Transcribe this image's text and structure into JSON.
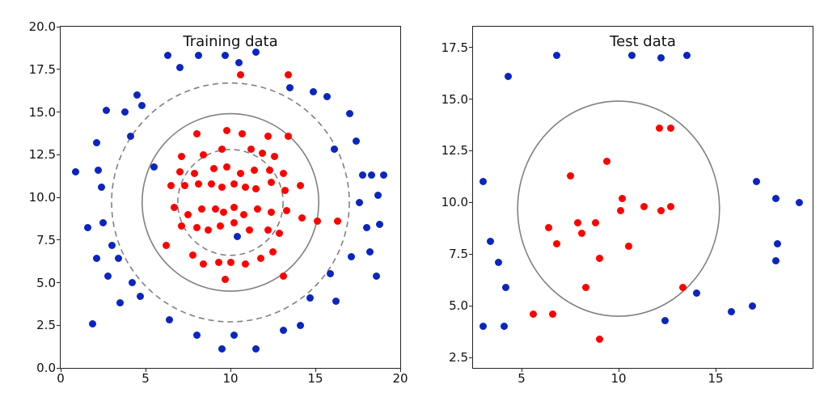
{
  "chart_data": [
    {
      "type": "scatter",
      "title": "Training data",
      "xlim": [
        0,
        20
      ],
      "ylim": [
        0,
        20
      ],
      "xticks": [
        0,
        5,
        10,
        15,
        20
      ],
      "yticks": [
        0.0,
        2.5,
        5.0,
        7.5,
        10.0,
        12.5,
        15.0,
        17.5,
        20.0
      ],
      "boundary_center": [
        10,
        9.7
      ],
      "boundary_radii": {
        "dashed_inner": 3.1,
        "solid": 5.2,
        "dashed_outer": 7.0
      },
      "series": [
        {
          "name": "class-red",
          "color": "#ff0000",
          "points": [
            [
              10.6,
              17.2
            ],
            [
              13.4,
              17.2
            ],
            [
              8.0,
              13.7
            ],
            [
              9.8,
              13.9
            ],
            [
              10.7,
              13.7
            ],
            [
              12.2,
              13.6
            ],
            [
              13.4,
              13.6
            ],
            [
              7.1,
              12.4
            ],
            [
              8.4,
              12.5
            ],
            [
              9.5,
              12.8
            ],
            [
              11.2,
              12.8
            ],
            [
              11.9,
              12.6
            ],
            [
              12.6,
              12.4
            ],
            [
              7.0,
              11.5
            ],
            [
              7.9,
              11.4
            ],
            [
              9.0,
              11.7
            ],
            [
              9.8,
              11.8
            ],
            [
              10.6,
              11.4
            ],
            [
              11.4,
              11.6
            ],
            [
              12.3,
              11.6
            ],
            [
              13.1,
              11.4
            ],
            [
              6.5,
              10.7
            ],
            [
              7.3,
              10.7
            ],
            [
              8.1,
              10.8
            ],
            [
              8.9,
              10.8
            ],
            [
              9.5,
              10.6
            ],
            [
              10.2,
              10.8
            ],
            [
              10.9,
              10.6
            ],
            [
              11.5,
              10.5
            ],
            [
              12.4,
              10.9
            ],
            [
              13.2,
              10.4
            ],
            [
              14.1,
              10.7
            ],
            [
              6.7,
              9.4
            ],
            [
              7.5,
              9.0
            ],
            [
              8.3,
              9.3
            ],
            [
              9.1,
              9.3
            ],
            [
              9.6,
              9.1
            ],
            [
              10.2,
              9.4
            ],
            [
              10.8,
              9.0
            ],
            [
              11.6,
              9.3
            ],
            [
              12.4,
              9.1
            ],
            [
              13.3,
              9.2
            ],
            [
              14.2,
              8.8
            ],
            [
              15.1,
              8.6
            ],
            [
              16.3,
              8.6
            ],
            [
              7.1,
              8.3
            ],
            [
              8.0,
              8.2
            ],
            [
              8.7,
              8.1
            ],
            [
              9.4,
              8.3
            ],
            [
              10.2,
              8.5
            ],
            [
              11.1,
              8.1
            ],
            [
              12.2,
              8.1
            ],
            [
              12.9,
              7.9
            ],
            [
              7.8,
              6.6
            ],
            [
              8.4,
              6.1
            ],
            [
              9.3,
              6.2
            ],
            [
              10.0,
              6.2
            ],
            [
              10.9,
              6.1
            ],
            [
              11.8,
              6.4
            ],
            [
              12.5,
              6.8
            ],
            [
              6.2,
              7.2
            ],
            [
              9.7,
              5.2
            ],
            [
              13.1,
              5.4
            ]
          ]
        },
        {
          "name": "class-blue",
          "color": "#0b25c0",
          "points": [
            [
              6.3,
              18.3
            ],
            [
              8.1,
              18.3
            ],
            [
              9.7,
              18.3
            ],
            [
              11.5,
              18.5
            ],
            [
              7.0,
              17.6
            ],
            [
              10.5,
              17.9
            ],
            [
              4.5,
              16.0
            ],
            [
              13.5,
              16.4
            ],
            [
              14.9,
              16.2
            ],
            [
              15.7,
              15.9
            ],
            [
              2.7,
              15.1
            ],
            [
              3.8,
              15.0
            ],
            [
              4.8,
              15.4
            ],
            [
              17.0,
              14.9
            ],
            [
              2.1,
              13.2
            ],
            [
              4.1,
              13.6
            ],
            [
              16.1,
              12.8
            ],
            [
              17.4,
              13.3
            ],
            [
              0.9,
              11.5
            ],
            [
              2.2,
              11.6
            ],
            [
              17.8,
              11.3
            ],
            [
              18.3,
              11.3
            ],
            [
              19.0,
              11.3
            ],
            [
              2.4,
              10.6
            ],
            [
              17.6,
              9.7
            ],
            [
              18.7,
              10.1
            ],
            [
              1.6,
              8.2
            ],
            [
              2.5,
              8.5
            ],
            [
              18.0,
              8.2
            ],
            [
              18.8,
              8.4
            ],
            [
              2.1,
              6.4
            ],
            [
              3.4,
              6.4
            ],
            [
              3.0,
              7.2
            ],
            [
              17.1,
              6.5
            ],
            [
              18.2,
              6.8
            ],
            [
              2.8,
              5.4
            ],
            [
              4.2,
              5.0
            ],
            [
              15.9,
              5.5
            ],
            [
              18.6,
              5.4
            ],
            [
              3.5,
              3.8
            ],
            [
              4.7,
              4.2
            ],
            [
              14.7,
              4.1
            ],
            [
              16.2,
              3.9
            ],
            [
              1.9,
              2.6
            ],
            [
              6.4,
              2.8
            ],
            [
              8.0,
              1.9
            ],
            [
              9.5,
              1.1
            ],
            [
              10.2,
              1.9
            ],
            [
              11.5,
              1.1
            ],
            [
              13.1,
              2.2
            ],
            [
              14.1,
              2.5
            ],
            [
              5.5,
              11.8
            ],
            [
              10.4,
              7.7
            ]
          ]
        }
      ]
    },
    {
      "type": "scatter",
      "title": "Test data",
      "xlim": [
        2.5,
        20
      ],
      "ylim": [
        2,
        18.5
      ],
      "xticks": [
        5,
        10,
        15
      ],
      "yticks": [
        2.5,
        5.0,
        7.5,
        10.0,
        12.5,
        15.0,
        17.5
      ],
      "boundary_center": [
        10,
        9.7
      ],
      "boundary_radii": {
        "solid": 5.2
      },
      "series": [
        {
          "name": "class-red",
          "color": "#ff0000",
          "points": [
            [
              12.1,
              13.6
            ],
            [
              12.7,
              13.6
            ],
            [
              9.4,
              12.0
            ],
            [
              7.5,
              11.3
            ],
            [
              10.2,
              10.2
            ],
            [
              10.1,
              9.6
            ],
            [
              11.3,
              9.8
            ],
            [
              12.2,
              9.6
            ],
            [
              12.7,
              9.8
            ],
            [
              6.4,
              8.8
            ],
            [
              7.9,
              9.0
            ],
            [
              8.8,
              9.0
            ],
            [
              6.8,
              8.0
            ],
            [
              8.1,
              8.5
            ],
            [
              10.5,
              7.9
            ],
            [
              9.0,
              7.3
            ],
            [
              8.3,
              5.9
            ],
            [
              13.3,
              5.9
            ],
            [
              6.6,
              4.6
            ],
            [
              5.6,
              4.6
            ],
            [
              9.0,
              3.4
            ]
          ]
        },
        {
          "name": "class-blue",
          "color": "#0b25c0",
          "points": [
            [
              6.8,
              17.1
            ],
            [
              10.7,
              17.1
            ],
            [
              12.2,
              17.0
            ],
            [
              13.5,
              17.1
            ],
            [
              4.3,
              16.1
            ],
            [
              3.0,
              11.0
            ],
            [
              17.1,
              11.0
            ],
            [
              18.1,
              10.2
            ],
            [
              19.3,
              10.0
            ],
            [
              3.4,
              8.1
            ],
            [
              18.2,
              8.0
            ],
            [
              3.8,
              7.1
            ],
            [
              18.1,
              7.2
            ],
            [
              4.2,
              5.9
            ],
            [
              12.4,
              4.3
            ],
            [
              14.0,
              5.6
            ],
            [
              15.8,
              4.7
            ],
            [
              16.9,
              5.0
            ],
            [
              3.0,
              4.0
            ],
            [
              4.1,
              4.0
            ]
          ]
        }
      ]
    }
  ]
}
